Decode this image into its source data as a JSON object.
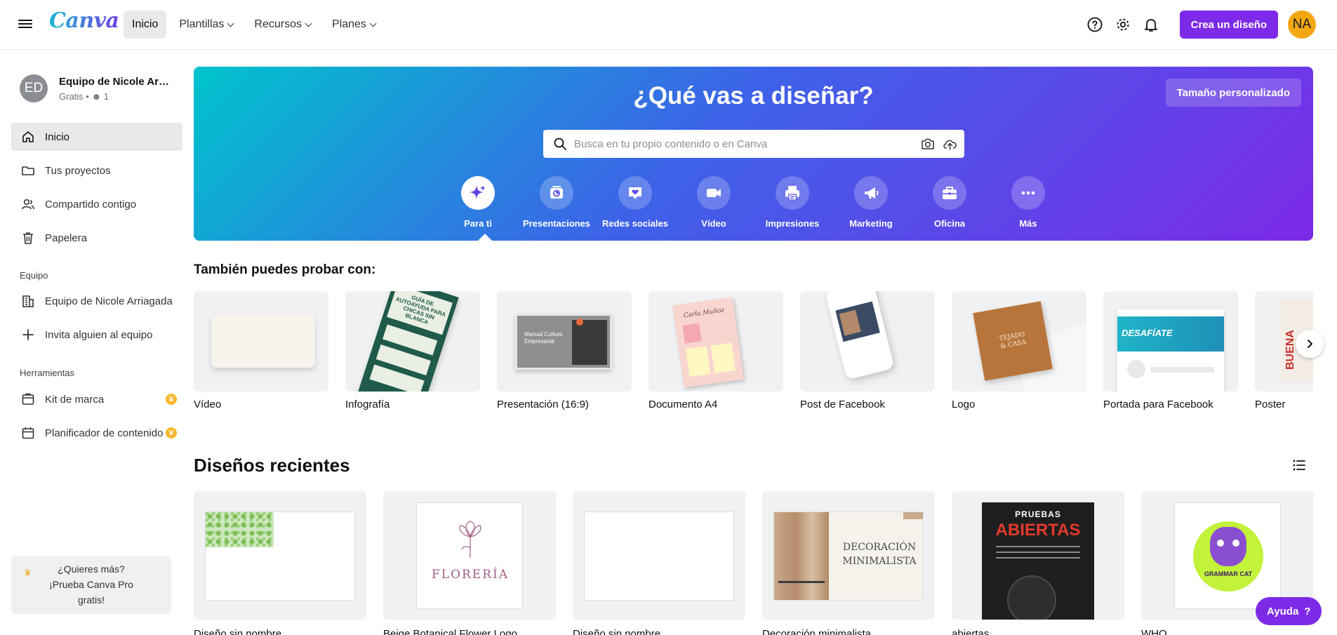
{
  "header": {
    "logo": "Canva",
    "nav": [
      {
        "label": "Inicio"
      },
      {
        "label": "Plantillas"
      },
      {
        "label": "Recursos"
      },
      {
        "label": "Planes"
      }
    ],
    "create_label": "Crea un diseño",
    "user_initials": "NA"
  },
  "sidebar": {
    "team_initials": "ED",
    "team_name": "Equipo de Nicole Arri...",
    "team_plan": "Gratis",
    "team_members": "1",
    "items": [
      {
        "label": "Inicio",
        "icon": "home-icon"
      },
      {
        "label": "Tus proyectos",
        "icon": "folder-icon"
      },
      {
        "label": "Compartido contigo",
        "icon": "people-icon"
      },
      {
        "label": "Papelera",
        "icon": "trash-icon"
      }
    ],
    "team_section": "Equipo",
    "team_items": [
      {
        "label": "Equipo de Nicole Arriagada",
        "icon": "building-icon"
      },
      {
        "label": "Invita alguien al equipo",
        "icon": "plus-icon"
      }
    ],
    "tools_section": "Herramientas",
    "tool_items": [
      {
        "label": "Kit de marca",
        "icon": "brand-kit-icon"
      },
      {
        "label": "Planificador de contenido",
        "icon": "calendar-icon"
      }
    ],
    "promo_line1": "¿Quieres más?",
    "promo_line2": "¡Prueba Canva Pro",
    "promo_line3": "gratis!"
  },
  "hero": {
    "title": "¿Qué vas a diseñar?",
    "custom_size": "Tamaño personalizado",
    "search_placeholder": "Busca en tu propio contenido o en Canva",
    "categories": [
      {
        "label": "Para ti",
        "icon": "sparkle-icon"
      },
      {
        "label": "Presentaciones",
        "icon": "presentation-icon"
      },
      {
        "label": "Redes sociales",
        "icon": "heart-chat-icon"
      },
      {
        "label": "Vídeo",
        "icon": "video-camera-icon"
      },
      {
        "label": "Impresiones",
        "icon": "printer-icon"
      },
      {
        "label": "Marketing",
        "icon": "megaphone-icon"
      },
      {
        "label": "Oficina",
        "icon": "briefcase-icon"
      },
      {
        "label": "Más",
        "icon": "more-dots-icon"
      }
    ]
  },
  "try": {
    "title": "También puedes probar con:",
    "items": [
      {
        "label": "Vídeo"
      },
      {
        "label": "Infografía"
      },
      {
        "label": "Presentación (16:9)"
      },
      {
        "label": "Documento A4"
      },
      {
        "label": "Post de Facebook"
      },
      {
        "label": "Logo"
      },
      {
        "label": "Portada para Facebook"
      },
      {
        "label": "Poster"
      }
    ],
    "thumb_text": {
      "infografia": "GUÍA DE AUTOAYUDA PARA CHICAS SIN BLANCA",
      "presentacion": "Manual Cultura Empresarial",
      "documento": "Carla Muñoz",
      "logo_line1": "TEJADO",
      "logo_line2": "& CASA",
      "portada": "DESAFÍATE",
      "poster": "BUENA"
    }
  },
  "recent": {
    "title": "Diseños recientes",
    "items": [
      {
        "label": "Diseño sin nombre"
      },
      {
        "label": "Beige Botanical Flower Logo"
      },
      {
        "label": "Diseño sin nombre"
      },
      {
        "label": "Decoración minimalista"
      },
      {
        "label": "abiertas"
      },
      {
        "label": "WHO"
      }
    ],
    "thumb_text": {
      "floreria": "FLORERÍA",
      "deco_line1": "DECORACIÓN",
      "deco_line2": "MINIMALISTA",
      "pruebas": "PRUEBAS",
      "abiertas": "ABIERTAS",
      "grammar": "GRAMMAR CAT"
    }
  },
  "help_label": "Ayuda"
}
